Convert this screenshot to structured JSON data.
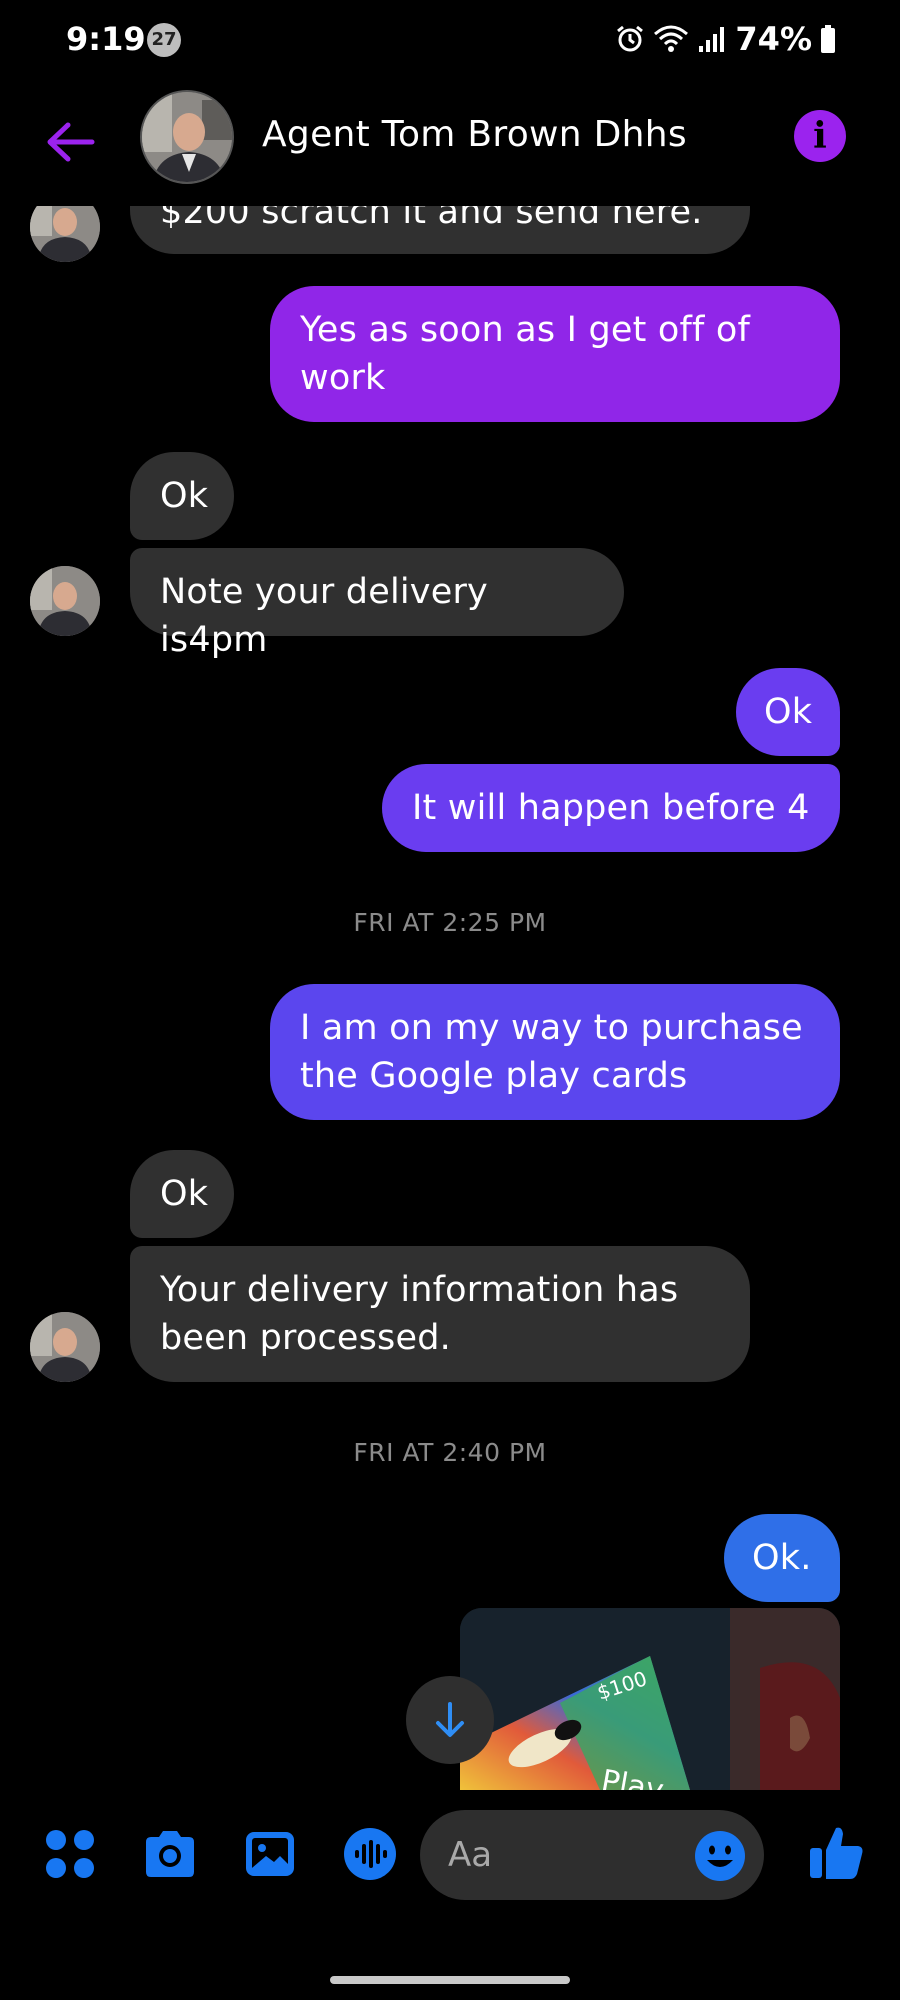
{
  "status_bar": {
    "time": "9:19",
    "notification_count": "27",
    "battery": "74%"
  },
  "header": {
    "contact_name": "Agent Tom Brown Dhhs",
    "info_label": "i"
  },
  "messages": [
    {
      "side": "in",
      "text": "$200 scratch it and send here."
    },
    {
      "side": "out",
      "text": "Yes as soon as I get off of work"
    },
    {
      "side": "in",
      "text": "Ok"
    },
    {
      "side": "in",
      "text": "Note your delivery is4pm"
    },
    {
      "side": "out",
      "text": "Ok"
    },
    {
      "side": "out",
      "text": "It will happen before 4"
    },
    {
      "type": "timestamp",
      "text": "FRI AT 2:25 PM"
    },
    {
      "side": "out",
      "text": "I am on my way to purchase the Google play cards"
    },
    {
      "side": "in",
      "text": "Ok"
    },
    {
      "side": "in",
      "text": "Your delivery information has been processed."
    },
    {
      "type": "timestamp",
      "text": "FRI AT 2:40 PM"
    },
    {
      "side": "out",
      "text": "Ok."
    }
  ],
  "photo": {
    "card_value": "$100",
    "card_text": "Play"
  },
  "composer": {
    "placeholder": "Aa"
  },
  "colors": {
    "accent_purple": "#9b23ee",
    "composer_blue": "#1877f2",
    "incoming_bubble": "#303030"
  },
  "icons": [
    "back-arrow-icon",
    "info-icon",
    "menu-grid-icon",
    "camera-icon",
    "image-icon",
    "voice-icon",
    "emoji-icon",
    "like-icon",
    "arrow-down-icon"
  ]
}
